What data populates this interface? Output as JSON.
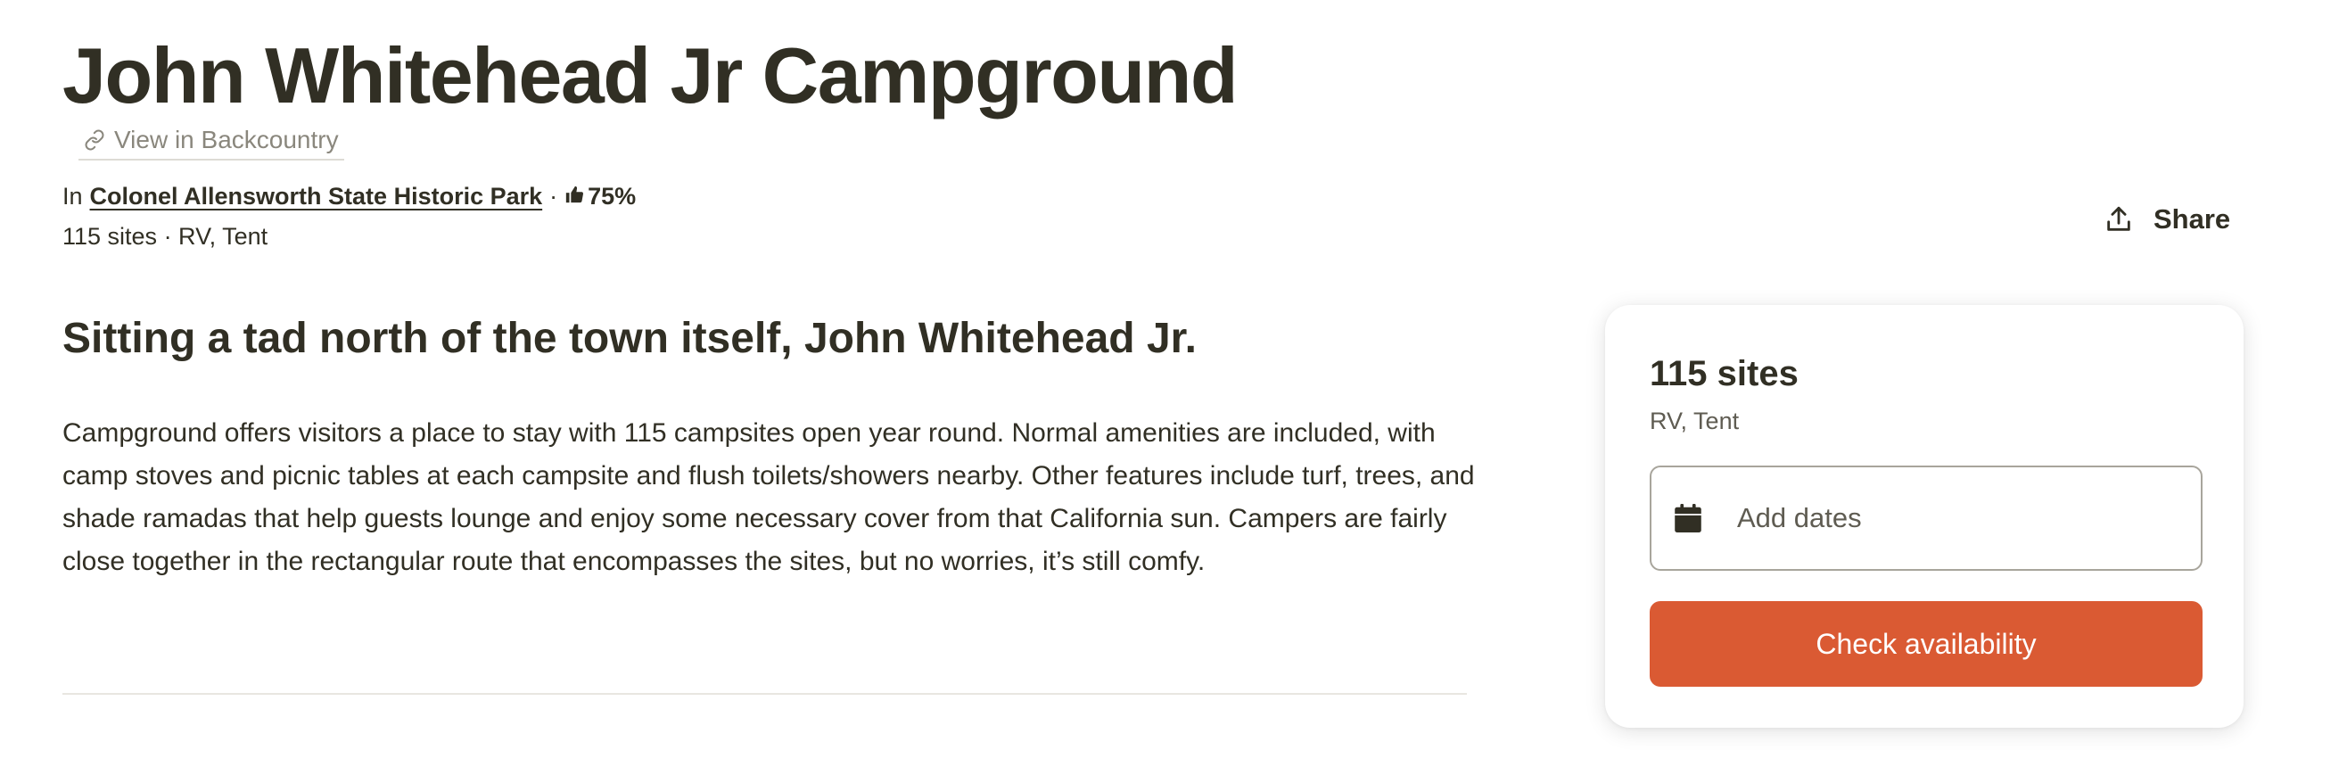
{
  "campground": {
    "title": "John Whitehead Jr Campground",
    "view_link_label": "View in Backcountry",
    "park_prefix": "In",
    "park_name": "Colonel Allensworth State Historic Park",
    "separator": "·",
    "rating": "75%",
    "site_summary": "115 sites · RV, Tent"
  },
  "share": {
    "label": "Share"
  },
  "description": {
    "heading": "Sitting a tad north of the town itself, John Whitehead Jr.",
    "body": "Campground offers visitors a place to stay with 115 campsites open year round. Normal amenities are included, with camp stoves and picnic tables at each campsite and flush toilets/showers nearby. Other features include turf, trees, and shade ramadas that help guests lounge and enjoy some necessary cover from that California sun. Campers are fairly close together in the rectangular route that encompasses the sites, but no worries, it’s still comfy."
  },
  "booking_card": {
    "title": "115 sites",
    "subtitle": "RV, Tent",
    "date_placeholder": "Add dates",
    "button_label": "Check availability"
  },
  "icons": {
    "view_link": "link-icon",
    "rating": "thumbs-up-icon",
    "share": "share-upload-icon",
    "date": "calendar-icon"
  },
  "colors": {
    "text": "#312f24",
    "muted": "#8a877d",
    "accent": "#da5a33",
    "border": "#a8a59c"
  }
}
